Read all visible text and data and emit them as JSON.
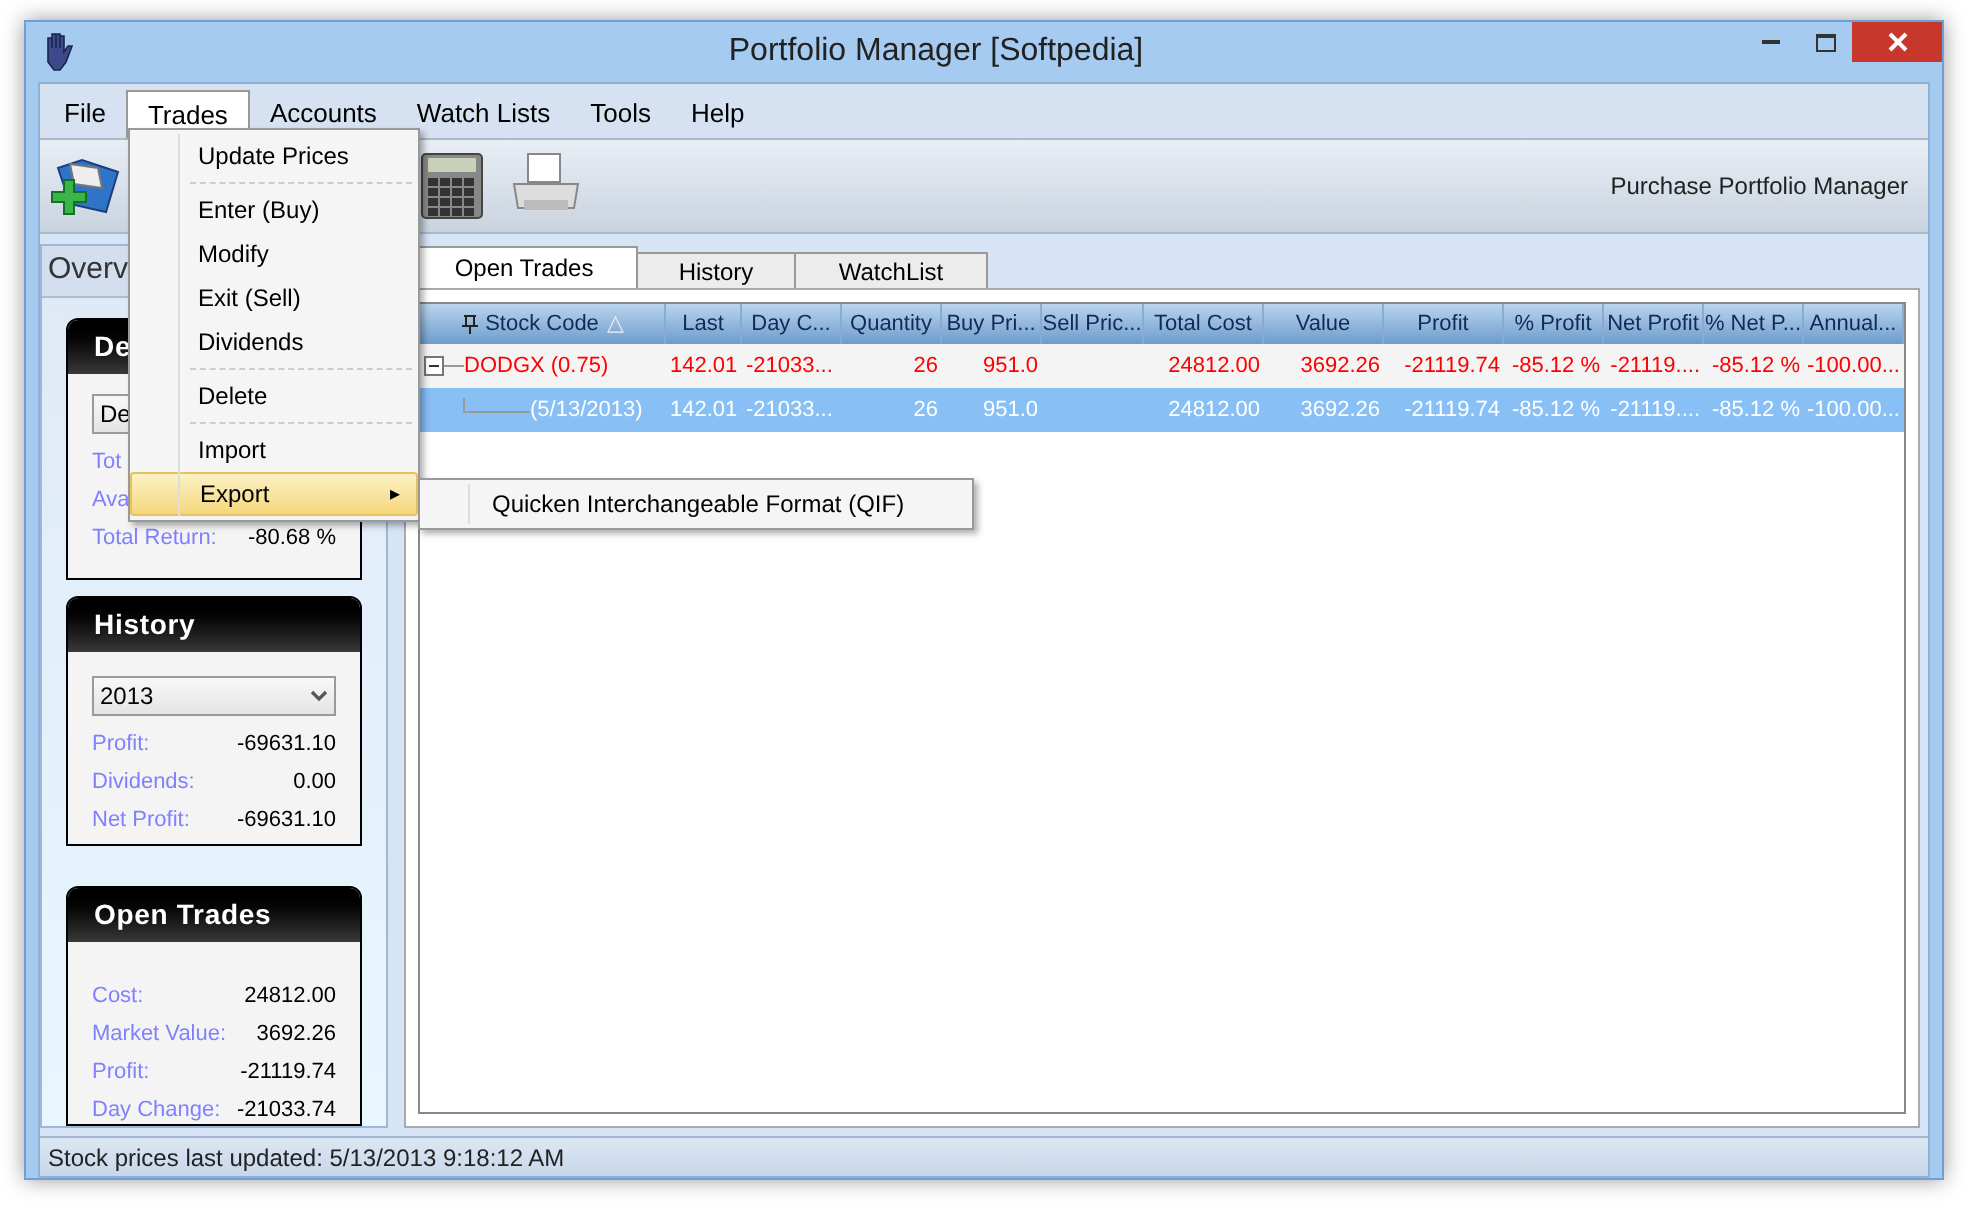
{
  "window": {
    "title": "Portfolio Manager [Softpedia]"
  },
  "menu_bar": [
    {
      "label": "File",
      "selected": false
    },
    {
      "label": "Trades",
      "selected": true
    },
    {
      "label": "Accounts",
      "selected": false
    },
    {
      "label": "Watch Lists",
      "selected": false
    },
    {
      "label": "Tools",
      "selected": false
    },
    {
      "label": "Help",
      "selected": false
    }
  ],
  "trades_menu": [
    {
      "kind": "item",
      "label": "Update Prices",
      "selected": false
    },
    {
      "kind": "separator"
    },
    {
      "kind": "item",
      "label": "Enter (Buy)",
      "selected": false
    },
    {
      "kind": "item",
      "label": "Modify",
      "selected": false
    },
    {
      "kind": "item",
      "label": "Exit (Sell)",
      "selected": false
    },
    {
      "kind": "item",
      "label": "Dividends",
      "selected": false
    },
    {
      "kind": "separator"
    },
    {
      "kind": "item",
      "label": "Delete",
      "selected": false
    },
    {
      "kind": "separator"
    },
    {
      "kind": "item",
      "label": "Import",
      "selected": false
    },
    {
      "kind": "submenu",
      "label": "Export",
      "selected": true,
      "arrow": "▸"
    }
  ],
  "export_submenu": [
    {
      "label": "Quicken Interchangeable Format (QIF)"
    }
  ],
  "toolbar": {
    "caption": "Purchase Portfolio Manager"
  },
  "overview": {
    "title": "Overv",
    "details": {
      "title": "De",
      "dropdown": "De",
      "rows": [
        {
          "label": "Tot"
        },
        {
          "label": "Ava"
        },
        {
          "label": "Total Return:",
          "value": "-80.68 %"
        }
      ]
    },
    "history": {
      "title": "History",
      "dropdown": "2013",
      "rows": [
        {
          "label": "Profit:",
          "value": "-69631.10"
        },
        {
          "label": "Dividends:",
          "value": "0.00"
        },
        {
          "label": "Net Profit:",
          "value": "-69631.10"
        }
      ]
    },
    "open_trades": {
      "title": "Open Trades",
      "rows": [
        {
          "label": "Cost:",
          "value": "24812.00"
        },
        {
          "label": "Market Value:",
          "value": "3692.26"
        },
        {
          "label": "Profit:",
          "value": "-21119.74"
        },
        {
          "label": "Day Change:",
          "value": "-21033.74"
        }
      ]
    }
  },
  "tabs": [
    {
      "label": "Open Trades",
      "selected": true
    },
    {
      "label": "History",
      "selected": false
    },
    {
      "label": "WatchList",
      "selected": false
    }
  ],
  "table": {
    "sort_mark": "△",
    "columns": [
      "Stock Code",
      "Last",
      "Day C...",
      "Quantity",
      "Buy Pri...",
      "Sell Pric...",
      "Total Cost",
      "Value",
      "Profit",
      "% Profit",
      "Net Profit",
      "% Net P...",
      "Annual..."
    ],
    "rows": [
      {
        "cells": [
          "DODGX (0.75)",
          "142.01",
          "-21033...",
          "26",
          "951.0",
          "",
          "24812.00",
          "3692.26",
          "-21119.74",
          "-85.12 %",
          "-21119....",
          "-85.12 %",
          "-100.00..."
        ],
        "selected": false,
        "expanded": true,
        "children": [
          {
            "cells": [
              "(5/13/2013)",
              "142.01",
              "-21033...",
              "26",
              "951.0",
              "",
              "24812.00",
              "3692.26",
              "-21119.74",
              "-85.12 %",
              "-21119....",
              "-85.12 %",
              "-100.00..."
            ],
            "selected": true
          }
        ]
      }
    ]
  },
  "status_bar": {
    "text": "Stock prices last updated: 5/13/2013 9:18:12 AM"
  }
}
